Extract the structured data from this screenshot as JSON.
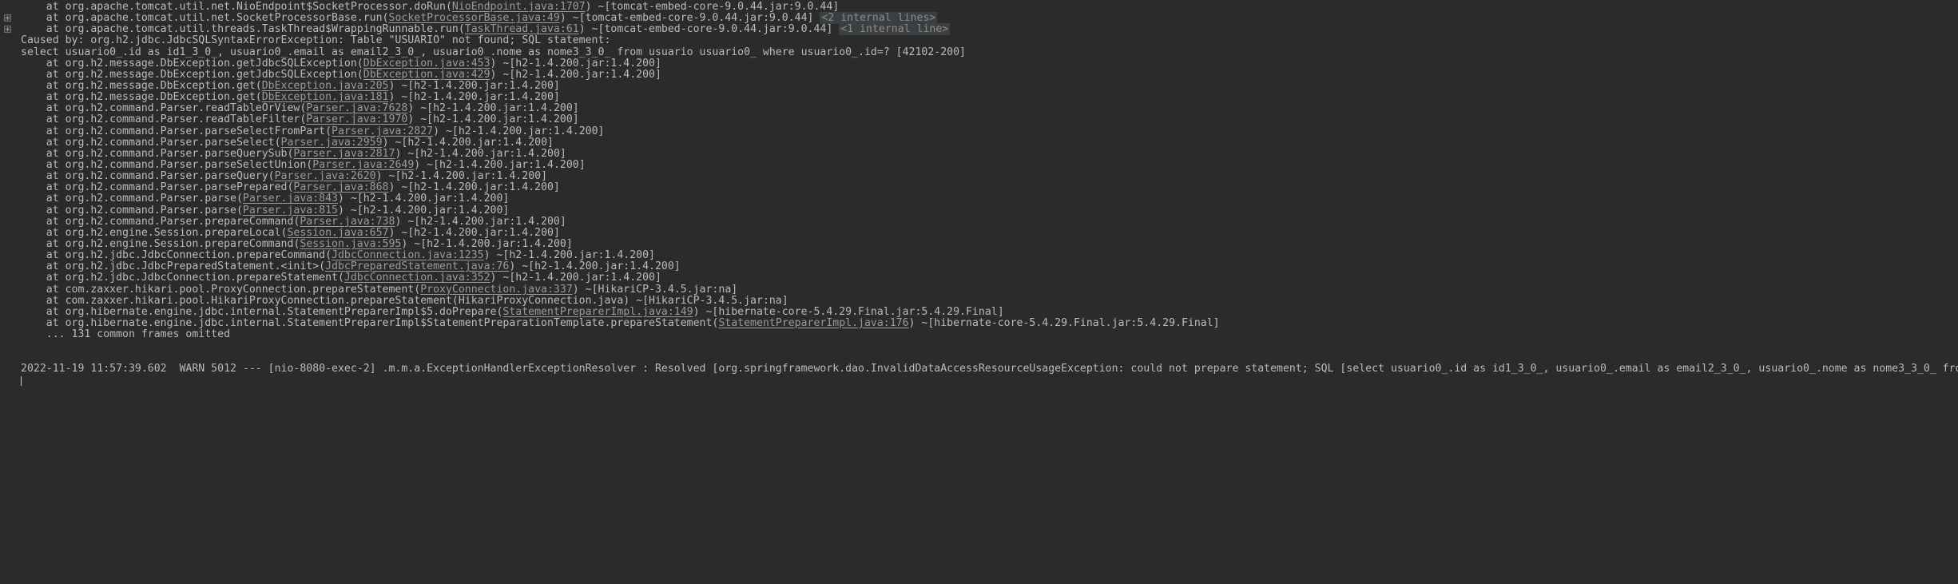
{
  "console": {
    "app": "IntelliJ IDEA Run Console",
    "background_color": "#2b2b2b",
    "text_color": "#bbbbbb",
    "link_color": "#9a9a9a",
    "badge_background": "#3c3f41",
    "gutter_icon": "expand-plus-icon",
    "lines": [
      {
        "id": "line-1",
        "gutter": false,
        "segments": [
          {
            "type": "text",
            "text": "    at org.apache.tomcat.util.net.NioEndpoint$SocketProcessor.doRun("
          },
          {
            "type": "link",
            "text": "NioEndpoint.java:1707"
          },
          {
            "type": "text",
            "text": ") ~[tomcat-embed-core-9.0.44.jar:9.0.44]"
          }
        ]
      },
      {
        "id": "line-2",
        "gutter": true,
        "segments": [
          {
            "type": "text",
            "text": "    at org.apache.tomcat.util.net.SocketProcessorBase.run("
          },
          {
            "type": "link",
            "text": "SocketProcessorBase.java:49"
          },
          {
            "type": "text",
            "text": ") ~[tomcat-embed-core-9.0.44.jar:9.0.44] "
          },
          {
            "type": "badge",
            "text": "<2 internal lines>"
          }
        ]
      },
      {
        "id": "line-3",
        "gutter": true,
        "segments": [
          {
            "type": "text",
            "text": "    at org.apache.tomcat.util.threads.TaskThread$WrappingRunnable.run("
          },
          {
            "type": "link",
            "text": "TaskThread.java:61"
          },
          {
            "type": "text",
            "text": ") ~[tomcat-embed-core-9.0.44.jar:9.0.44] "
          },
          {
            "type": "badge",
            "text": "<1 internal line>"
          }
        ]
      },
      {
        "id": "line-4",
        "gutter": false,
        "segments": [
          {
            "type": "text",
            "text": "Caused by: org.h2.jdbc.JdbcSQLSyntaxErrorException: Table \"USUARIO\" not found; SQL statement:"
          }
        ]
      },
      {
        "id": "line-5",
        "gutter": false,
        "segments": [
          {
            "type": "text",
            "text": "select usuario0_.id as id1_3_0_, usuario0_.email as email2_3_0_, usuario0_.nome as nome3_3_0_ from usuario usuario0_ where usuario0_.id=? [42102-200]"
          }
        ]
      },
      {
        "id": "line-6",
        "gutter": false,
        "segments": [
          {
            "type": "text",
            "text": "    at org.h2.message.DbException.getJdbcSQLException("
          },
          {
            "type": "link",
            "text": "DbException.java:453"
          },
          {
            "type": "text",
            "text": ") ~[h2-1.4.200.jar:1.4.200]"
          }
        ]
      },
      {
        "id": "line-7",
        "gutter": false,
        "segments": [
          {
            "type": "text",
            "text": "    at org.h2.message.DbException.getJdbcSQLException("
          },
          {
            "type": "link",
            "text": "DbException.java:429"
          },
          {
            "type": "text",
            "text": ") ~[h2-1.4.200.jar:1.4.200]"
          }
        ]
      },
      {
        "id": "line-8",
        "gutter": false,
        "segments": [
          {
            "type": "text",
            "text": "    at org.h2.message.DbException.get("
          },
          {
            "type": "link",
            "text": "DbException.java:205"
          },
          {
            "type": "text",
            "text": ") ~[h2-1.4.200.jar:1.4.200]"
          }
        ]
      },
      {
        "id": "line-9",
        "gutter": false,
        "segments": [
          {
            "type": "text",
            "text": "    at org.h2.message.DbException.get("
          },
          {
            "type": "link",
            "text": "DbException.java:181"
          },
          {
            "type": "text",
            "text": ") ~[h2-1.4.200.jar:1.4.200]"
          }
        ]
      },
      {
        "id": "line-10",
        "gutter": false,
        "segments": [
          {
            "type": "text",
            "text": "    at org.h2.command.Parser.readTableOrView("
          },
          {
            "type": "link",
            "text": "Parser.java:7628"
          },
          {
            "type": "text",
            "text": ") ~[h2-1.4.200.jar:1.4.200]"
          }
        ]
      },
      {
        "id": "line-11",
        "gutter": false,
        "segments": [
          {
            "type": "text",
            "text": "    at org.h2.command.Parser.readTableFilter("
          },
          {
            "type": "link",
            "text": "Parser.java:1970"
          },
          {
            "type": "text",
            "text": ") ~[h2-1.4.200.jar:1.4.200]"
          }
        ]
      },
      {
        "id": "line-12",
        "gutter": false,
        "segments": [
          {
            "type": "text",
            "text": "    at org.h2.command.Parser.parseSelectFromPart("
          },
          {
            "type": "link",
            "text": "Parser.java:2827"
          },
          {
            "type": "text",
            "text": ") ~[h2-1.4.200.jar:1.4.200]"
          }
        ]
      },
      {
        "id": "line-13",
        "gutter": false,
        "segments": [
          {
            "type": "text",
            "text": "    at org.h2.command.Parser.parseSelect("
          },
          {
            "type": "link",
            "text": "Parser.java:2959"
          },
          {
            "type": "text",
            "text": ") ~[h2-1.4.200.jar:1.4.200]"
          }
        ]
      },
      {
        "id": "line-14",
        "gutter": false,
        "segments": [
          {
            "type": "text",
            "text": "    at org.h2.command.Parser.parseQuerySub("
          },
          {
            "type": "link",
            "text": "Parser.java:2817"
          },
          {
            "type": "text",
            "text": ") ~[h2-1.4.200.jar:1.4.200]"
          }
        ]
      },
      {
        "id": "line-15",
        "gutter": false,
        "segments": [
          {
            "type": "text",
            "text": "    at org.h2.command.Parser.parseSelectUnion("
          },
          {
            "type": "link",
            "text": "Parser.java:2649"
          },
          {
            "type": "text",
            "text": ") ~[h2-1.4.200.jar:1.4.200]"
          }
        ]
      },
      {
        "id": "line-16",
        "gutter": false,
        "segments": [
          {
            "type": "text",
            "text": "    at org.h2.command.Parser.parseQuery("
          },
          {
            "type": "link",
            "text": "Parser.java:2620"
          },
          {
            "type": "text",
            "text": ") ~[h2-1.4.200.jar:1.4.200]"
          }
        ]
      },
      {
        "id": "line-17",
        "gutter": false,
        "segments": [
          {
            "type": "text",
            "text": "    at org.h2.command.Parser.parsePrepared("
          },
          {
            "type": "link",
            "text": "Parser.java:868"
          },
          {
            "type": "text",
            "text": ") ~[h2-1.4.200.jar:1.4.200]"
          }
        ]
      },
      {
        "id": "line-18",
        "gutter": false,
        "segments": [
          {
            "type": "text",
            "text": "    at org.h2.command.Parser.parse("
          },
          {
            "type": "link",
            "text": "Parser.java:843"
          },
          {
            "type": "text",
            "text": ") ~[h2-1.4.200.jar:1.4.200]"
          }
        ]
      },
      {
        "id": "line-19",
        "gutter": false,
        "segments": [
          {
            "type": "text",
            "text": "    at org.h2.command.Parser.parse("
          },
          {
            "type": "link",
            "text": "Parser.java:815"
          },
          {
            "type": "text",
            "text": ") ~[h2-1.4.200.jar:1.4.200]"
          }
        ]
      },
      {
        "id": "line-20",
        "gutter": false,
        "segments": [
          {
            "type": "text",
            "text": "    at org.h2.command.Parser.prepareCommand("
          },
          {
            "type": "link",
            "text": "Parser.java:738"
          },
          {
            "type": "text",
            "text": ") ~[h2-1.4.200.jar:1.4.200]"
          }
        ]
      },
      {
        "id": "line-21",
        "gutter": false,
        "segments": [
          {
            "type": "text",
            "text": "    at org.h2.engine.Session.prepareLocal("
          },
          {
            "type": "link",
            "text": "Session.java:657"
          },
          {
            "type": "text",
            "text": ") ~[h2-1.4.200.jar:1.4.200]"
          }
        ]
      },
      {
        "id": "line-22",
        "gutter": false,
        "segments": [
          {
            "type": "text",
            "text": "    at org.h2.engine.Session.prepareCommand("
          },
          {
            "type": "link",
            "text": "Session.java:595"
          },
          {
            "type": "text",
            "text": ") ~[h2-1.4.200.jar:1.4.200]"
          }
        ]
      },
      {
        "id": "line-23",
        "gutter": false,
        "segments": [
          {
            "type": "text",
            "text": "    at org.h2.jdbc.JdbcConnection.prepareCommand("
          },
          {
            "type": "link",
            "text": "JdbcConnection.java:1235"
          },
          {
            "type": "text",
            "text": ") ~[h2-1.4.200.jar:1.4.200]"
          }
        ]
      },
      {
        "id": "line-24",
        "gutter": false,
        "segments": [
          {
            "type": "text",
            "text": "    at org.h2.jdbc.JdbcPreparedStatement.<init>("
          },
          {
            "type": "link",
            "text": "JdbcPreparedStatement.java:76"
          },
          {
            "type": "text",
            "text": ") ~[h2-1.4.200.jar:1.4.200]"
          }
        ]
      },
      {
        "id": "line-25",
        "gutter": false,
        "segments": [
          {
            "type": "text",
            "text": "    at org.h2.jdbc.JdbcConnection.prepareStatement("
          },
          {
            "type": "link",
            "text": "JdbcConnection.java:352"
          },
          {
            "type": "text",
            "text": ") ~[h2-1.4.200.jar:1.4.200]"
          }
        ]
      },
      {
        "id": "line-26",
        "gutter": false,
        "segments": [
          {
            "type": "text",
            "text": "    at com.zaxxer.hikari.pool.ProxyConnection.prepareStatement("
          },
          {
            "type": "link",
            "text": "ProxyConnection.java:337"
          },
          {
            "type": "text",
            "text": ") ~[HikariCP-3.4.5.jar:na]"
          }
        ]
      },
      {
        "id": "line-27",
        "gutter": false,
        "segments": [
          {
            "type": "text",
            "text": "    at com.zaxxer.hikari.pool.HikariProxyConnection.prepareStatement(HikariProxyConnection.java) ~[HikariCP-3.4.5.jar:na]"
          }
        ]
      },
      {
        "id": "line-28",
        "gutter": false,
        "segments": [
          {
            "type": "text",
            "text": "    at org.hibernate.engine.jdbc.internal.StatementPreparerImpl$5.doPrepare("
          },
          {
            "type": "link",
            "text": "StatementPreparerImpl.java:149"
          },
          {
            "type": "text",
            "text": ") ~[hibernate-core-5.4.29.Final.jar:5.4.29.Final]"
          }
        ]
      },
      {
        "id": "line-29",
        "gutter": false,
        "segments": [
          {
            "type": "text",
            "text": "    at org.hibernate.engine.jdbc.internal.StatementPreparerImpl$StatementPreparationTemplate.prepareStatement("
          },
          {
            "type": "link",
            "text": "StatementPreparerImpl.java:176"
          },
          {
            "type": "text",
            "text": ") ~[hibernate-core-5.4.29.Final.jar:5.4.29.Final]"
          }
        ]
      },
      {
        "id": "line-30",
        "gutter": false,
        "segments": [
          {
            "type": "text",
            "text": "    ... 131 common frames omitted"
          }
        ]
      },
      {
        "id": "line-31",
        "gutter": false,
        "segments": []
      },
      {
        "id": "line-32",
        "gutter": false,
        "segments": []
      },
      {
        "id": "line-33",
        "gutter": false,
        "segments": [
          {
            "type": "text",
            "text": "2022-11-19 11:57:39.602  WARN 5012 --- [nio-8080-exec-2] .m.m.a.ExceptionHandlerExceptionResolver : Resolved [org.springframework.dao.InvalidDataAccessResourceUsageException: could not prepare statement; SQL [select usuario0_.id as id1_3_0_, usuario0_.email as email2_3_0_, usuario0_.nome as nome3_3_0_ fro"
          }
        ]
      },
      {
        "id": "line-34",
        "gutter": false,
        "cursor": true,
        "segments": []
      }
    ]
  }
}
